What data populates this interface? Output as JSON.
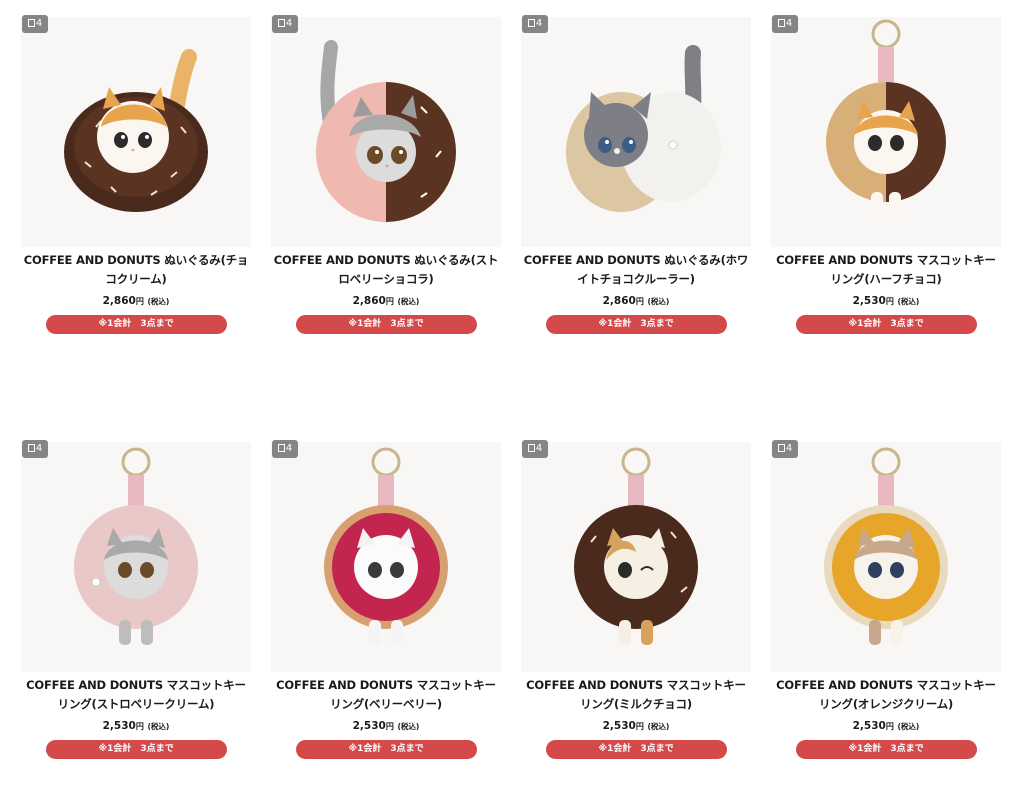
{
  "colors": {
    "limit_button": "#d44a4b",
    "badge": "#858585",
    "image_bg": "#f8f7f5"
  },
  "products": [
    {
      "badge": "4",
      "title": "COFFEE AND DONUTS ぬいぐるみ(チョコクリーム)",
      "price": "2,860",
      "currency": "円",
      "tax": "(税込)",
      "limit": "※1会計　3点まで",
      "image": "plush-calico-chocolate-donut"
    },
    {
      "badge": "4",
      "title": "COFFEE AND DONUTS ぬいぐるみ(ストロベリーショコラ)",
      "price": "2,860",
      "currency": "円",
      "tax": "(税込)",
      "limit": "※1会計　3点まで",
      "image": "plush-tabby-strawberry-chocolate-donut"
    },
    {
      "badge": "4",
      "title": "COFFEE AND DONUTS ぬいぐるみ(ホワイトチョコクルーラー)",
      "price": "2,860",
      "currency": "円",
      "tax": "(税込)",
      "limit": "※1会計　3点まで",
      "image": "plush-grey-white-chocolate-cruller"
    },
    {
      "badge": "4",
      "title": "COFFEE AND DONUTS マスコットキーリング(ハーフチョコ)",
      "price": "2,530",
      "currency": "円",
      "tax": "(税込)",
      "limit": "※1会計　3点まで",
      "image": "keyring-half-chocolate-donut"
    },
    {
      "badge": "4",
      "title": "COFFEE AND DONUTS マスコットキーリング(ストロベリークリーム)",
      "price": "2,530",
      "currency": "円",
      "tax": "(税込)",
      "limit": "※1会計　3点まで",
      "image": "keyring-strawberry-cream-donut"
    },
    {
      "badge": "4",
      "title": "COFFEE AND DONUTS マスコットキーリング(ベリーベリー)",
      "price": "2,530",
      "currency": "円",
      "tax": "(税込)",
      "limit": "※1会計　3点まで",
      "image": "keyring-berry-berry-donut"
    },
    {
      "badge": "4",
      "title": "COFFEE AND DONUTS マスコットキーリング(ミルクチョコ)",
      "price": "2,530",
      "currency": "円",
      "tax": "(税込)",
      "limit": "※1会計　3点まで",
      "image": "keyring-milk-chocolate-donut"
    },
    {
      "badge": "4",
      "title": "COFFEE AND DONUTS マスコットキーリング(オレンジクリーム)",
      "price": "2,530",
      "currency": "円",
      "tax": "(税込)",
      "limit": "※1会計　3点まで",
      "image": "keyring-orange-cream-donut"
    }
  ]
}
